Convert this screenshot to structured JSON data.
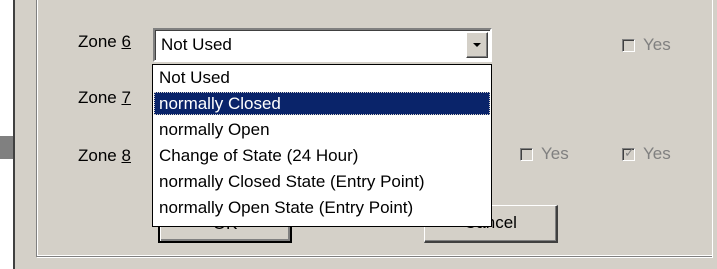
{
  "zones": [
    {
      "label_prefix": "Zone ",
      "label_key": "6"
    },
    {
      "label_prefix": "Zone ",
      "label_key": "7"
    },
    {
      "label_prefix": "Zone ",
      "label_key": "8"
    }
  ],
  "combo": {
    "value": "Not Used"
  },
  "dropdown": {
    "options": [
      "Not Used",
      "normally Closed",
      "normally Open",
      "Change of State (24 Hour)",
      "normally Closed State (Entry Point)",
      "normally Open State (Entry Point)"
    ],
    "selected_index": 1
  },
  "checkboxes": {
    "zone6_yes": {
      "label": "Yes",
      "checked": false
    },
    "zone8_yes_a": {
      "label": "Yes",
      "checked": false
    },
    "zone8_yes_b": {
      "label": "Yes",
      "checked": true
    }
  },
  "buttons": {
    "ok": "OK",
    "cancel": "Cancel"
  },
  "colors": {
    "selection": "#0a246a",
    "face": "#d4d0c8"
  }
}
